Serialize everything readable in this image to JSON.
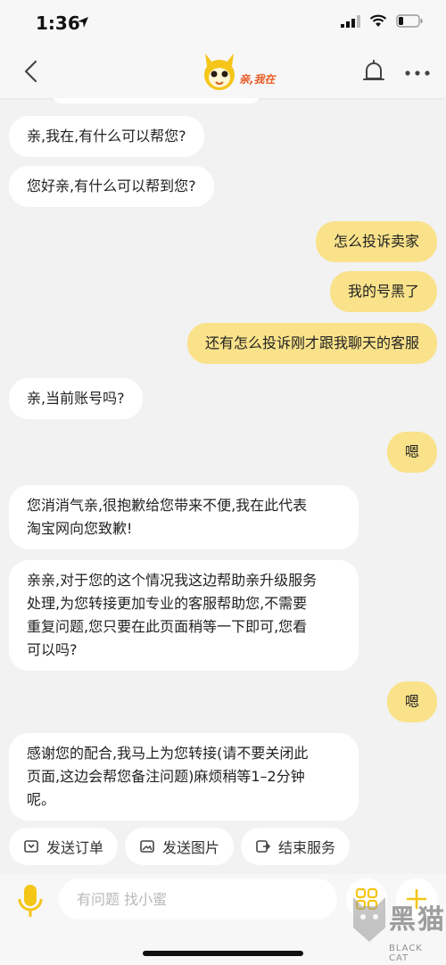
{
  "status_bar": {
    "time": "1:36"
  },
  "header": {
    "logo_text": "亲,我在"
  },
  "messages": [
    {
      "side": "left",
      "text": "亲,我在,有什么可以帮您?"
    },
    {
      "side": "left",
      "text": "您好亲,有什么可以帮到您?"
    },
    {
      "side": "right",
      "text": "怎么投诉卖家"
    },
    {
      "side": "right",
      "text": "我的号黑了"
    },
    {
      "side": "right",
      "text": "还有怎么投诉刚才跟我聊天的客服"
    },
    {
      "side": "left",
      "text": "亲,当前账号吗?"
    },
    {
      "side": "right",
      "text": "嗯"
    },
    {
      "side": "left",
      "text": "您消消气亲,很抱歉给您带来不便,我在此代表\n淘宝网向您致歉!"
    },
    {
      "side": "left",
      "text": "亲亲,对于您的这个情况我这边帮助亲升级服务\n处理,为您转接更加专业的客服帮助您,不需要\n重复问题,您只要在此页面稍等一下即可,您看\n可以吗?"
    },
    {
      "side": "right",
      "text": "嗯"
    },
    {
      "side": "left",
      "text": "感谢您的配合,我马上为您转接(请不要关闭此\n页面,这边会帮您备注问题)麻烦稍等1–2分钟\n呢。"
    }
  ],
  "quick_actions": [
    {
      "label": "发送订单",
      "icon": "order-icon"
    },
    {
      "label": "发送图片",
      "icon": "image-icon"
    },
    {
      "label": "结束服务",
      "icon": "exit-icon"
    }
  ],
  "input": {
    "placeholder": "有问题 找小蜜"
  },
  "watermark": {
    "main": "黑猫",
    "sub": "BLACK CAT"
  },
  "colors": {
    "accent": "#f5c518",
    "bubble_right": "#f9e28a",
    "background": "#f2f2f2"
  }
}
